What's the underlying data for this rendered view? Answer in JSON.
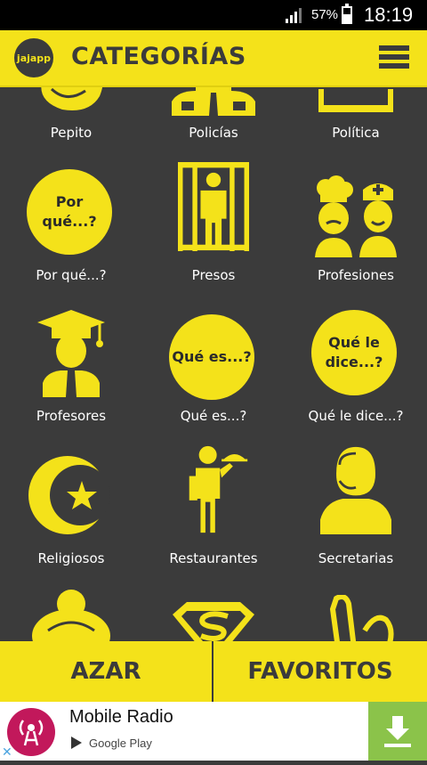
{
  "status": {
    "battery": "57%",
    "battery_level": 0.57,
    "time": "18:19"
  },
  "app": {
    "logo_text": "jajapp",
    "title": "CATEGORÍAS"
  },
  "categories": [
    {
      "label": "Pepito",
      "icon": "boy-face-icon"
    },
    {
      "label": "Policías",
      "icon": "police-officer-icon"
    },
    {
      "label": "Política",
      "icon": "politics-podium-icon"
    },
    {
      "label": "Por qué...?",
      "icon": "speech-bubble-icon",
      "bubble": "Por qué...?"
    },
    {
      "label": "Presos",
      "icon": "prisoner-bars-icon"
    },
    {
      "label": "Profesiones",
      "icon": "chef-and-nurse-icon"
    },
    {
      "label": "Profesores",
      "icon": "graduate-teacher-icon"
    },
    {
      "label": "Qué es...?",
      "icon": "speech-bubble-icon",
      "bubble": "Qué es...?"
    },
    {
      "label": "Qué le dice...?",
      "icon": "speech-bubble-icon",
      "bubble": "Qué le\ndice...?"
    },
    {
      "label": "Religiosos",
      "icon": "crescent-star-icon"
    },
    {
      "label": "Restaurantes",
      "icon": "waiter-icon"
    },
    {
      "label": "Secretarias",
      "icon": "secretary-headset-icon"
    },
    {
      "label": "",
      "icon": "woman-bun-icon"
    },
    {
      "label": "",
      "icon": "superhero-emblem-icon"
    },
    {
      "label": "",
      "icon": "foot-hand-icon"
    }
  ],
  "bottom": {
    "random": "AZAR",
    "favorites": "FAVORITOS"
  },
  "ad": {
    "title": "Mobile Radio",
    "store": "Google Play"
  },
  "colors": {
    "accent": "#f4e21a",
    "background": "#3b3b3b",
    "download": "#8bc34a"
  }
}
